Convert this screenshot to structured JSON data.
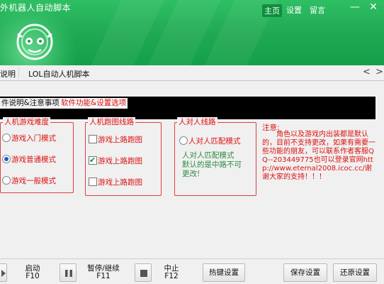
{
  "header": {
    "app_title": "外机器人自动脚本",
    "buttons": {
      "home": "主页",
      "settings": "设置",
      "message": "留言"
    },
    "window_controls": {
      "minimize": "—",
      "close": "✕"
    }
  },
  "tabbar": {
    "tabs": [
      "说明",
      "LOL自动人机脚本"
    ],
    "nav_prev": "<",
    "nav_next": ">"
  },
  "subtabs": [
    "件说明&注意事项",
    "软件功能&设置选项"
  ],
  "groups": {
    "difficulty": {
      "title": "人机游戏难度",
      "options": [
        {
          "label": "游戏入门模式",
          "selected": false
        },
        {
          "label": "游戏普通模式",
          "selected": true
        },
        {
          "label": "游戏一般模式",
          "selected": false
        }
      ]
    },
    "route": {
      "title": "人机跑图线路",
      "options": [
        {
          "label": "游戏上路跑图",
          "checked": false
        },
        {
          "label": "游戏上路跑图",
          "checked": true
        },
        {
          "label": "游戏上路跑图",
          "checked": false
        }
      ]
    },
    "pvp": {
      "title": "人对人线路",
      "option": {
        "label": "人对人匹配模式",
        "selected": false
      },
      "hint": "人对人匹配模式\n默认的是中路不可更改!"
    }
  },
  "note": {
    "title": "注意:",
    "text": "角色以及游戏内出装都是默认的，目前不支持更改，如果有需要一些功能的朋友，可以联系作者客服QQ--203449775也可以登录官网http://www.eternal2008.icoc.cc/谢谢大家的支持！！！"
  },
  "toolbar": {
    "start": "启动",
    "start_key": "F10",
    "pause": "暂停/继续",
    "pause_key": "F11",
    "stop": "中止",
    "stop_key": "F12",
    "hotkey": "热键设置",
    "save": "保存设置",
    "restore": "还原设置"
  },
  "colors": {
    "header_green": "#1fa852",
    "accent_red": "#dd1111",
    "hint_green": "#2c8a44"
  }
}
